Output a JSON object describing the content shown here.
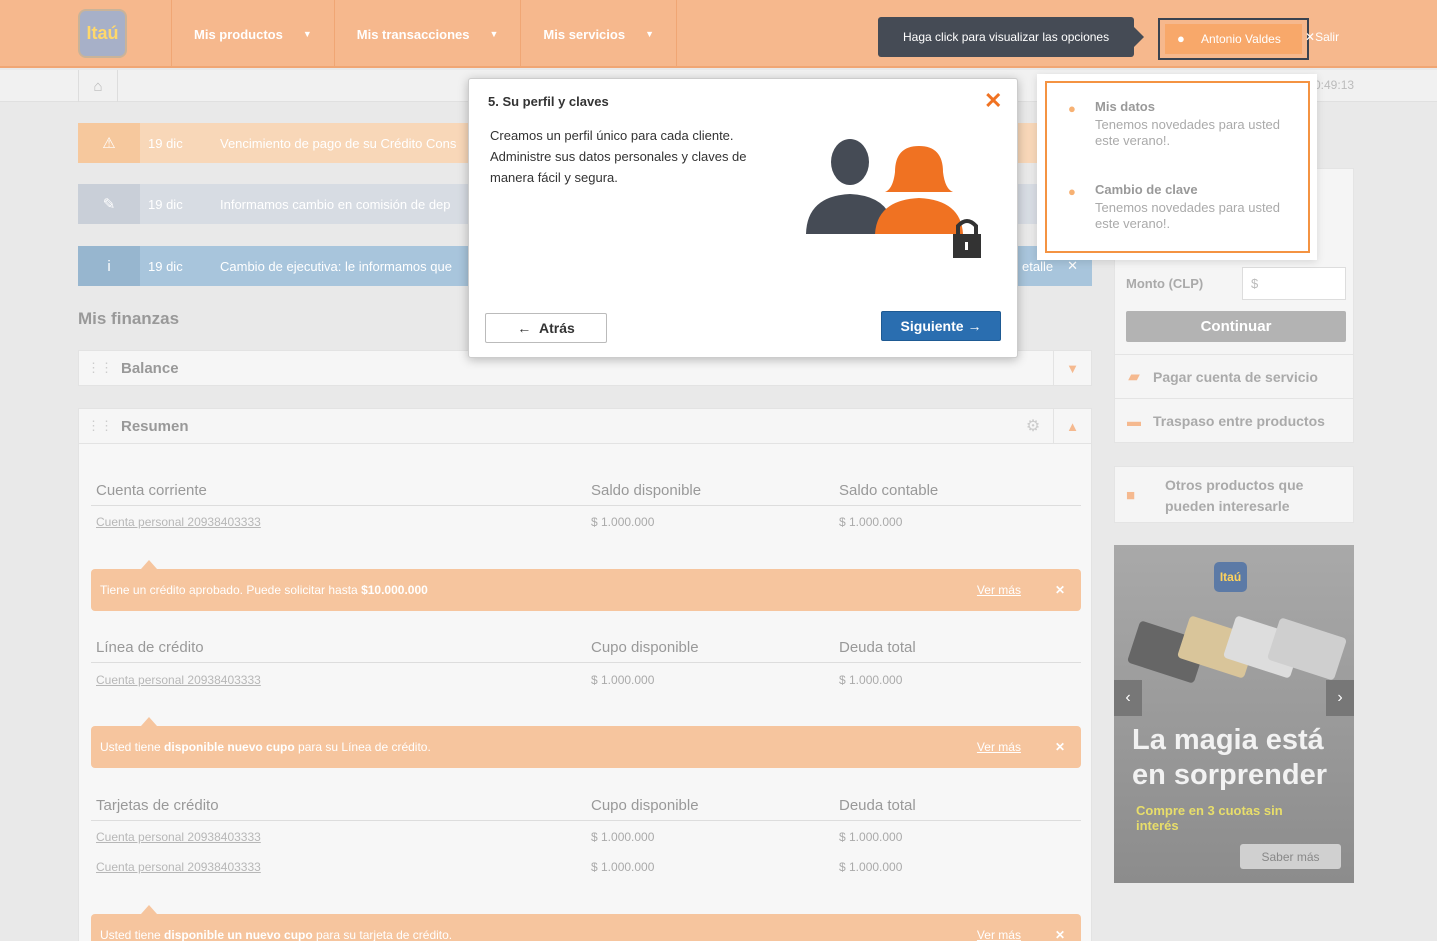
{
  "header": {
    "logo": "Itaú",
    "nav": [
      "Mis productos",
      "Mis transacciones",
      "Mis servicios"
    ],
    "tooltip": "Haga click para visualizar las opciones",
    "user": "Antonio Valdes",
    "logout": "Salir"
  },
  "subbar": {
    "time": "0:49:13"
  },
  "alerts": [
    {
      "date": "19 dic",
      "text": "Vencimiento de pago de su Crédito Cons",
      "right": "etalle"
    },
    {
      "date": "19 dic",
      "text": "Informamos cambio en comisión de dep",
      "right": ""
    },
    {
      "date": "19 dic",
      "text": "Cambio de ejecutiva: le informamos que",
      "right": "etalle"
    }
  ],
  "main": {
    "section_title": "Mis finanzas",
    "panels": [
      "Balance",
      "Resumen"
    ],
    "groups": [
      {
        "headers": [
          "Cuenta corriente",
          "Saldo disponible",
          "Saldo contable"
        ],
        "rows": [
          [
            "Cuenta personal 20938403333",
            "$ 1.000.000",
            "$ 1.000.000"
          ]
        ],
        "banner": {
          "pre": "Tiene un crédito aprobado. Puede solicitar hasta ",
          "bold": "$10.000.000",
          "post": "",
          "link": "Ver más"
        }
      },
      {
        "headers": [
          "Línea de crédito",
          "Cupo disponible",
          "Deuda total"
        ],
        "rows": [
          [
            "Cuenta personal 20938403333",
            "$ 1.000.000",
            "$ 1.000.000"
          ]
        ],
        "banner": {
          "pre": "Usted tiene ",
          "bold": "disponible nuevo cupo",
          "post": " para su Línea de crédito.",
          "link": "Ver más"
        }
      },
      {
        "headers": [
          "Tarjetas de crédito",
          "Cupo disponible",
          "Deuda total"
        ],
        "rows": [
          [
            "Cuenta personal 20938403333",
            "$ 1.000.000",
            "$ 1.000.000"
          ],
          [
            "Cuenta personal 20938403333",
            "$ 1.000.000",
            "$ 1.000.000"
          ]
        ],
        "banner": {
          "pre": "Usted tiene ",
          "bold": "disponible un nuevo cupo",
          "post": " para su tarjeta de crédito.",
          "link": "Ver más"
        }
      }
    ]
  },
  "right": {
    "monto_label": "Monto (CLP)",
    "monto_placeholder": "$",
    "continuar": "Continuar",
    "links": [
      "Pagar cuenta de servicio",
      "Traspaso entre productos"
    ],
    "other": "Otros productos que pueden interesarle",
    "ad": {
      "logo": "Itaú",
      "headline": "La magia está en sorprender",
      "sub": "Compre en 3 cuotas sin interés",
      "button": "Saber más"
    }
  },
  "dropdown": {
    "items": [
      {
        "title": "Mis datos",
        "desc": "Tenemos novedades para usted este verano!."
      },
      {
        "title": "Cambio de clave",
        "desc": "Tenemos novedades para usted este verano!."
      }
    ]
  },
  "modal": {
    "title": "5. Su perfil y claves",
    "body": "Creamos un perfil único para cada cliente. Administre sus datos personales y claves de manera fácil y segura.",
    "back": "Atrás",
    "next": "Siguiente"
  },
  "colors": {
    "brand_orange": "#f6b88d",
    "accent_orange": "#f07222",
    "primary_blue": "#2a6eb0"
  }
}
